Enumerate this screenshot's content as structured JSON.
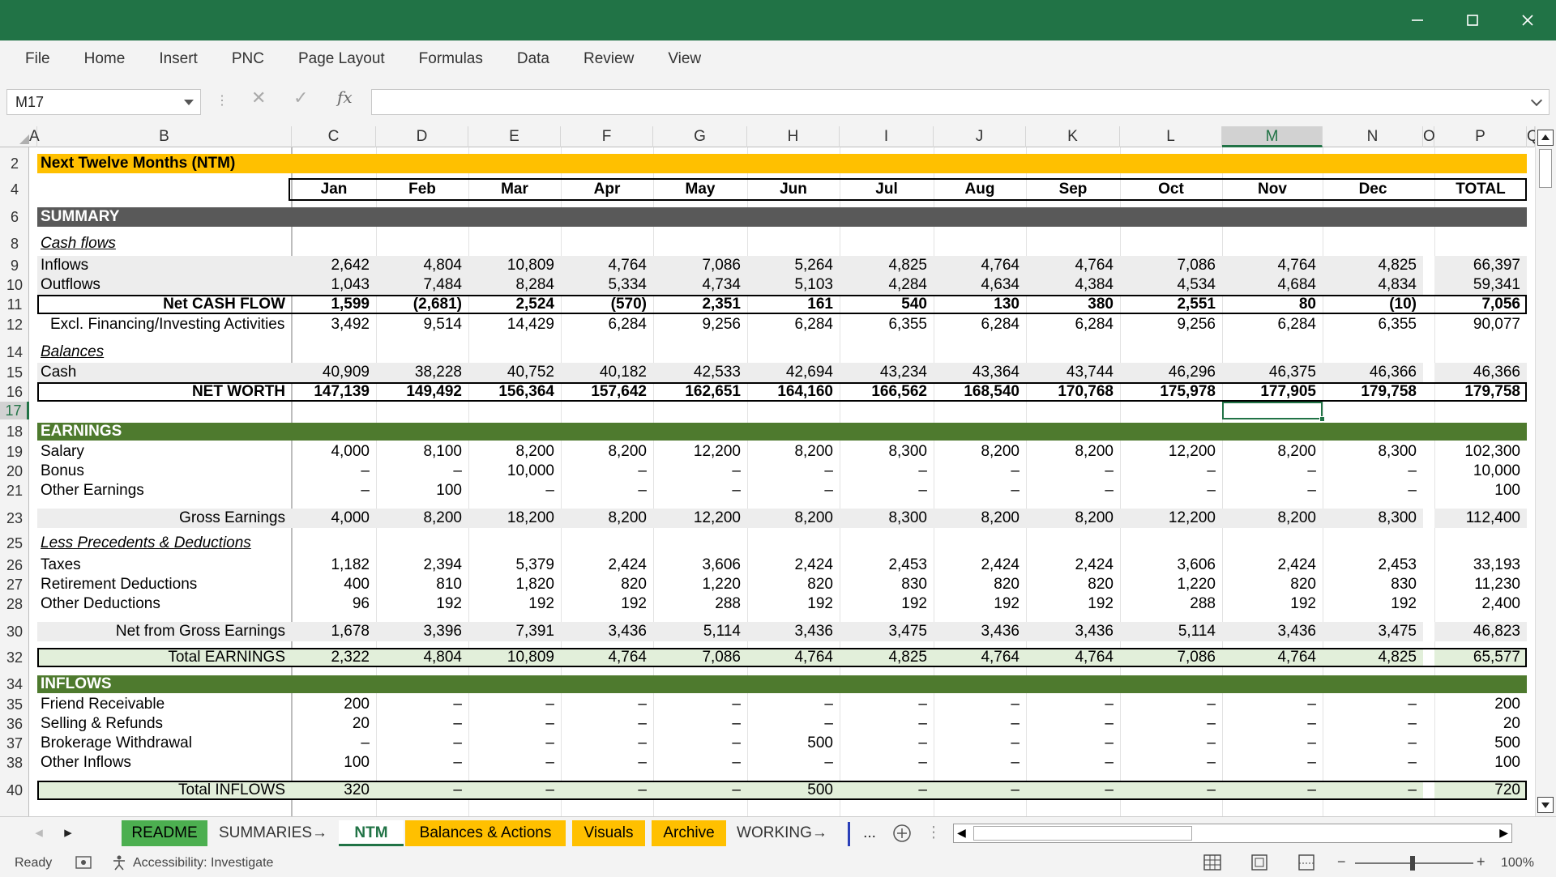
{
  "window": {
    "minimize_glyph": "—",
    "maximize_glyph": "☐",
    "close_glyph": "✕"
  },
  "menu": [
    "File",
    "Home",
    "Insert",
    "PNC",
    "Page Layout",
    "Formulas",
    "Data",
    "Review",
    "View"
  ],
  "formula_bar": {
    "name_box": "M17",
    "fx_label": "fx",
    "formula": ""
  },
  "columns": [
    "A",
    "B",
    "C",
    "D",
    "E",
    "F",
    "G",
    "H",
    "I",
    "J",
    "K",
    "L",
    "M",
    "N",
    "O",
    "P",
    "Q"
  ],
  "selected_cell": "M17",
  "colors": {
    "excel_green": "#217346",
    "ntm_header": "#FFC000",
    "summary_header": "#595959",
    "section_green": "#4E7A2E",
    "light_green": "#E2EFDA",
    "gray_band": "#EDEDED"
  },
  "sheet": {
    "title": "Next Twelve Months (NTM)",
    "months": [
      "Jan",
      "Feb",
      "Mar",
      "Apr",
      "May",
      "Jun",
      "Jul",
      "Aug",
      "Sep",
      "Oct",
      "Nov",
      "Dec"
    ],
    "total_label": "TOTAL",
    "rows": [
      {
        "row": "2",
        "type": "title",
        "label": "Next Twelve Months (NTM)"
      },
      {
        "row": "4",
        "type": "months"
      },
      {
        "row": "6",
        "type": "section-dark",
        "label": "SUMMARY"
      },
      {
        "row": "8",
        "type": "subhead",
        "label": "Cash flows"
      },
      {
        "row": "9",
        "type": "band",
        "label": "Inflows",
        "values": [
          "2,642",
          "4,804",
          "10,809",
          "4,764",
          "7,086",
          "5,264",
          "4,825",
          "4,764",
          "4,764",
          "7,086",
          "4,764",
          "4,825"
        ],
        "total": "66,397"
      },
      {
        "row": "10",
        "type": "band",
        "label": "Outflows",
        "values": [
          "1,043",
          "7,484",
          "8,284",
          "5,334",
          "4,734",
          "5,103",
          "4,284",
          "4,634",
          "4,384",
          "4,534",
          "4,684",
          "4,834"
        ],
        "total": "59,341"
      },
      {
        "row": "11",
        "type": "bold-box",
        "label": "Net CASH FLOW",
        "values": [
          "1,599",
          "(2,681)",
          "2,524",
          "(570)",
          "2,351",
          "161",
          "540",
          "130",
          "380",
          "2,551",
          "80",
          "(10)"
        ],
        "total": "7,056"
      },
      {
        "row": "12",
        "type": "plain-right",
        "label": "Excl. Financing/Investing Activities",
        "values": [
          "3,492",
          "9,514",
          "14,429",
          "6,284",
          "9,256",
          "6,284",
          "6,355",
          "6,284",
          "6,284",
          "9,256",
          "6,284",
          "6,355"
        ],
        "total": "90,077"
      },
      {
        "row": "14",
        "type": "subhead",
        "label": "Balances"
      },
      {
        "row": "15",
        "type": "band",
        "label": "Cash",
        "values": [
          "40,909",
          "38,228",
          "40,752",
          "40,182",
          "42,533",
          "42,694",
          "43,234",
          "43,364",
          "43,744",
          "46,296",
          "46,375",
          "46,366"
        ],
        "total": "46,366"
      },
      {
        "row": "16",
        "type": "bold-box",
        "label": "NET WORTH",
        "values": [
          "147,139",
          "149,492",
          "156,364",
          "157,642",
          "162,651",
          "164,160",
          "166,562",
          "168,540",
          "170,768",
          "175,978",
          "177,905",
          "179,758"
        ],
        "total": "179,758"
      },
      {
        "row": "17",
        "type": "empty"
      },
      {
        "row": "18",
        "type": "section-green",
        "label": "EARNINGS"
      },
      {
        "row": "19",
        "type": "line",
        "label": "Salary",
        "values": [
          "4,000",
          "8,100",
          "8,200",
          "8,200",
          "12,200",
          "8,200",
          "8,300",
          "8,200",
          "8,200",
          "12,200",
          "8,200",
          "8,300"
        ],
        "total": "102,300"
      },
      {
        "row": "20",
        "type": "line",
        "label": "Bonus",
        "values": [
          "–",
          "–",
          "10,000",
          "–",
          "–",
          "–",
          "–",
          "–",
          "–",
          "–",
          "–",
          "–"
        ],
        "total": "10,000"
      },
      {
        "row": "21",
        "type": "line",
        "label": "Other Earnings",
        "values": [
          "–",
          "100",
          "–",
          "–",
          "–",
          "–",
          "–",
          "–",
          "–",
          "–",
          "–",
          "–"
        ],
        "total": "100"
      },
      {
        "row": "23",
        "type": "subtotal",
        "label": "Gross Earnings",
        "values": [
          "4,000",
          "8,200",
          "18,200",
          "8,200",
          "12,200",
          "8,200",
          "8,300",
          "8,200",
          "8,200",
          "12,200",
          "8,200",
          "8,300"
        ],
        "total": "112,400"
      },
      {
        "row": "25",
        "type": "subhead",
        "label": "Less Precedents & Deductions"
      },
      {
        "row": "26",
        "type": "line",
        "label": "Taxes",
        "values": [
          "1,182",
          "2,394",
          "5,379",
          "2,424",
          "3,606",
          "2,424",
          "2,453",
          "2,424",
          "2,424",
          "3,606",
          "2,424",
          "2,453"
        ],
        "total": "33,193"
      },
      {
        "row": "27",
        "type": "line",
        "label": "Retirement Deductions",
        "values": [
          "400",
          "810",
          "1,820",
          "820",
          "1,220",
          "820",
          "830",
          "820",
          "820",
          "1,220",
          "820",
          "830"
        ],
        "total": "11,230"
      },
      {
        "row": "28",
        "type": "line",
        "label": "Other Deductions",
        "values": [
          "96",
          "192",
          "192",
          "192",
          "288",
          "192",
          "192",
          "192",
          "192",
          "288",
          "192",
          "192"
        ],
        "total": "2,400"
      },
      {
        "row": "30",
        "type": "subtotal",
        "label": "Net from Gross Earnings",
        "values": [
          "1,678",
          "3,396",
          "7,391",
          "3,436",
          "5,114",
          "3,436",
          "3,475",
          "3,436",
          "3,436",
          "5,114",
          "3,436",
          "3,475"
        ],
        "total": "46,823"
      },
      {
        "row": "32",
        "type": "total-green",
        "label": "Total EARNINGS",
        "values": [
          "2,322",
          "4,804",
          "10,809",
          "4,764",
          "7,086",
          "4,764",
          "4,825",
          "4,764",
          "4,764",
          "7,086",
          "4,764",
          "4,825"
        ],
        "total": "65,577"
      },
      {
        "row": "34",
        "type": "section-green",
        "label": "INFLOWS"
      },
      {
        "row": "35",
        "type": "line",
        "label": "Friend Receivable",
        "values": [
          "200",
          "–",
          "–",
          "–",
          "–",
          "–",
          "–",
          "–",
          "–",
          "–",
          "–",
          "–"
        ],
        "total": "200"
      },
      {
        "row": "36",
        "type": "line",
        "label": "Selling & Refunds",
        "values": [
          "20",
          "–",
          "–",
          "–",
          "–",
          "–",
          "–",
          "–",
          "–",
          "–",
          "–",
          "–"
        ],
        "total": "20"
      },
      {
        "row": "37",
        "type": "line",
        "label": "Brokerage Withdrawal",
        "values": [
          "–",
          "–",
          "–",
          "–",
          "–",
          "500",
          "–",
          "–",
          "–",
          "–",
          "–",
          "–"
        ],
        "total": "500"
      },
      {
        "row": "38",
        "type": "line",
        "label": "Other Inflows",
        "values": [
          "100",
          "–",
          "–",
          "–",
          "–",
          "–",
          "–",
          "–",
          "–",
          "–",
          "–",
          "–"
        ],
        "total": "100"
      },
      {
        "row": "40",
        "type": "total-green",
        "label": "Total INFLOWS",
        "values": [
          "320",
          "–",
          "–",
          "–",
          "–",
          "500",
          "–",
          "–",
          "–",
          "–",
          "–",
          "–"
        ],
        "total": "720"
      }
    ]
  },
  "tabs": [
    {
      "label": "README",
      "bg": "#4CAF50",
      "color": "#000"
    },
    {
      "label": "SUMMARIES→",
      "bg": "",
      "color": "#333"
    },
    {
      "label": "NTM",
      "bg": "",
      "color": "#217346",
      "active": true
    },
    {
      "label": "Balances & Actions",
      "bg": "#FFC000",
      "color": "#000"
    },
    {
      "label": "Visuals",
      "bg": "#FFC000",
      "color": "#000"
    },
    {
      "label": "Archive",
      "bg": "#FFC000",
      "color": "#000"
    },
    {
      "label": "WORKING→",
      "bg": "",
      "color": "#333"
    }
  ],
  "tab_more": "...",
  "status": {
    "ready": "Ready",
    "accessibility": "Accessibility: Investigate",
    "zoom": "100%"
  }
}
